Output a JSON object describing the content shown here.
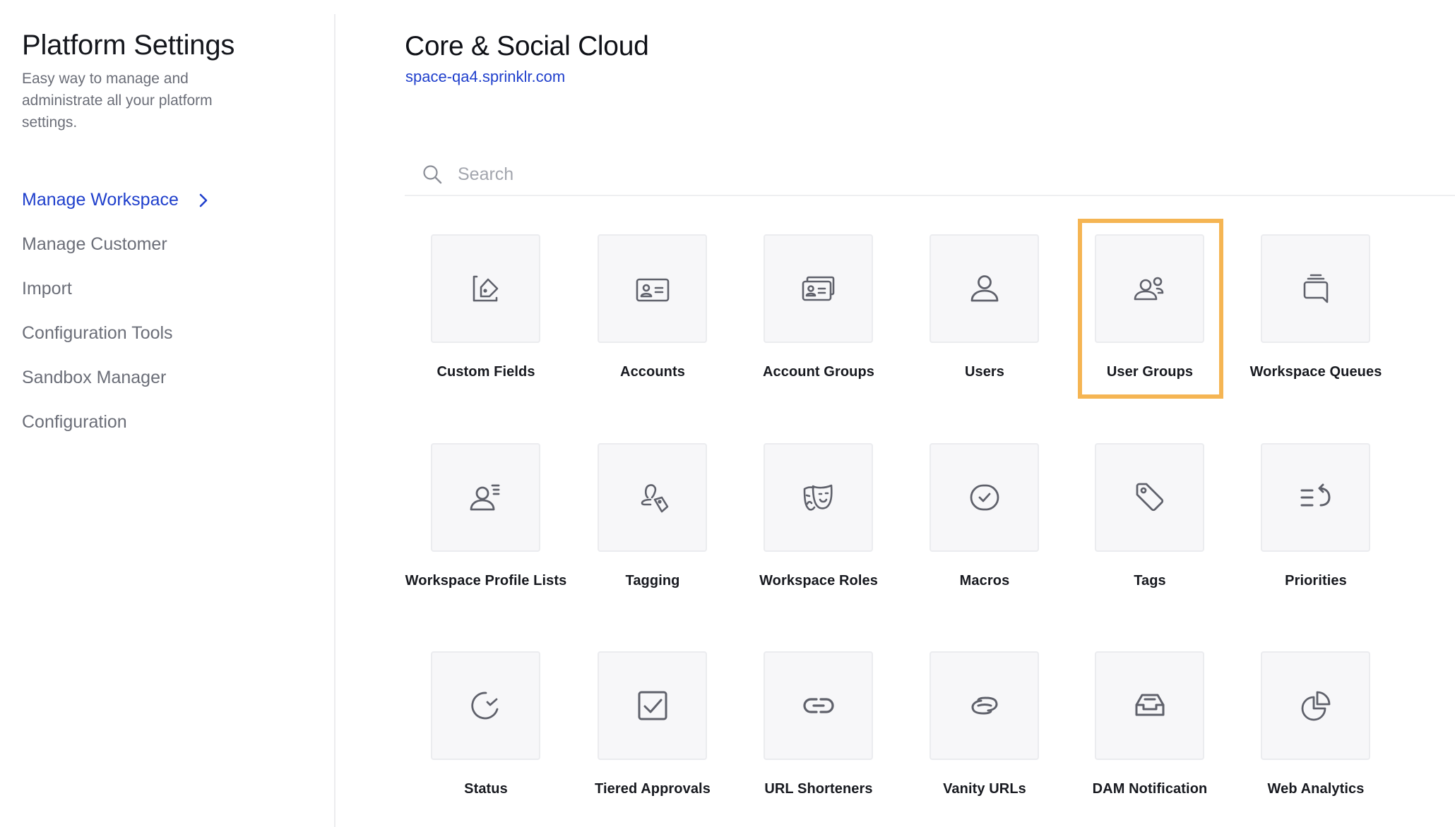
{
  "sidebar": {
    "title": "Platform Settings",
    "description": "Easy way to manage and administrate all your platform settings.",
    "items": [
      {
        "label": "Manage Workspace",
        "active": true,
        "icon": "chevron-right-icon"
      },
      {
        "label": "Manage Customer",
        "active": false
      },
      {
        "label": "Import",
        "active": false
      },
      {
        "label": "Configuration Tools",
        "active": false
      },
      {
        "label": "Sandbox Manager",
        "active": false
      },
      {
        "label": "Configuration",
        "active": false
      }
    ]
  },
  "main": {
    "title": "Core & Social Cloud",
    "subtitle_link": "space-qa4.sprinklr.com",
    "search": {
      "placeholder": "Search",
      "value": "",
      "icon": "search-icon"
    },
    "highlighted_item": "User Groups",
    "items": [
      {
        "label": "Custom Fields",
        "icon": "edit-tag-icon"
      },
      {
        "label": "Accounts",
        "icon": "id-card-icon"
      },
      {
        "label": "Account Groups",
        "icon": "id-cards-stack-icon"
      },
      {
        "label": "Users",
        "icon": "user-icon"
      },
      {
        "label": "User Groups",
        "icon": "users-group-icon"
      },
      {
        "label": "Workspace Queues",
        "icon": "chat-queue-icon"
      },
      {
        "label": "Workspace Profile Lists",
        "icon": "user-list-icon"
      },
      {
        "label": "Tagging",
        "icon": "user-tag-icon"
      },
      {
        "label": "Workspace Roles",
        "icon": "theater-masks-icon"
      },
      {
        "label": "Macros",
        "icon": "check-circle-icon"
      },
      {
        "label": "Tags",
        "icon": "tag-icon"
      },
      {
        "label": "Priorities",
        "icon": "priority-list-icon"
      },
      {
        "label": "Status",
        "icon": "status-check-icon"
      },
      {
        "label": "Tiered Approvals",
        "icon": "checkbox-icon"
      },
      {
        "label": "URL Shorteners",
        "icon": "link-icon"
      },
      {
        "label": "Vanity URLs",
        "icon": "chain-link-icon"
      },
      {
        "label": "DAM Notification",
        "icon": "inbox-tray-icon"
      },
      {
        "label": "Web Analytics",
        "icon": "pie-chart-icon"
      }
    ]
  },
  "colors": {
    "accent": "#1f3fcc",
    "highlight": "#f5b553",
    "icon": "#5f616b",
    "tile_bg": "#f7f7f9"
  }
}
